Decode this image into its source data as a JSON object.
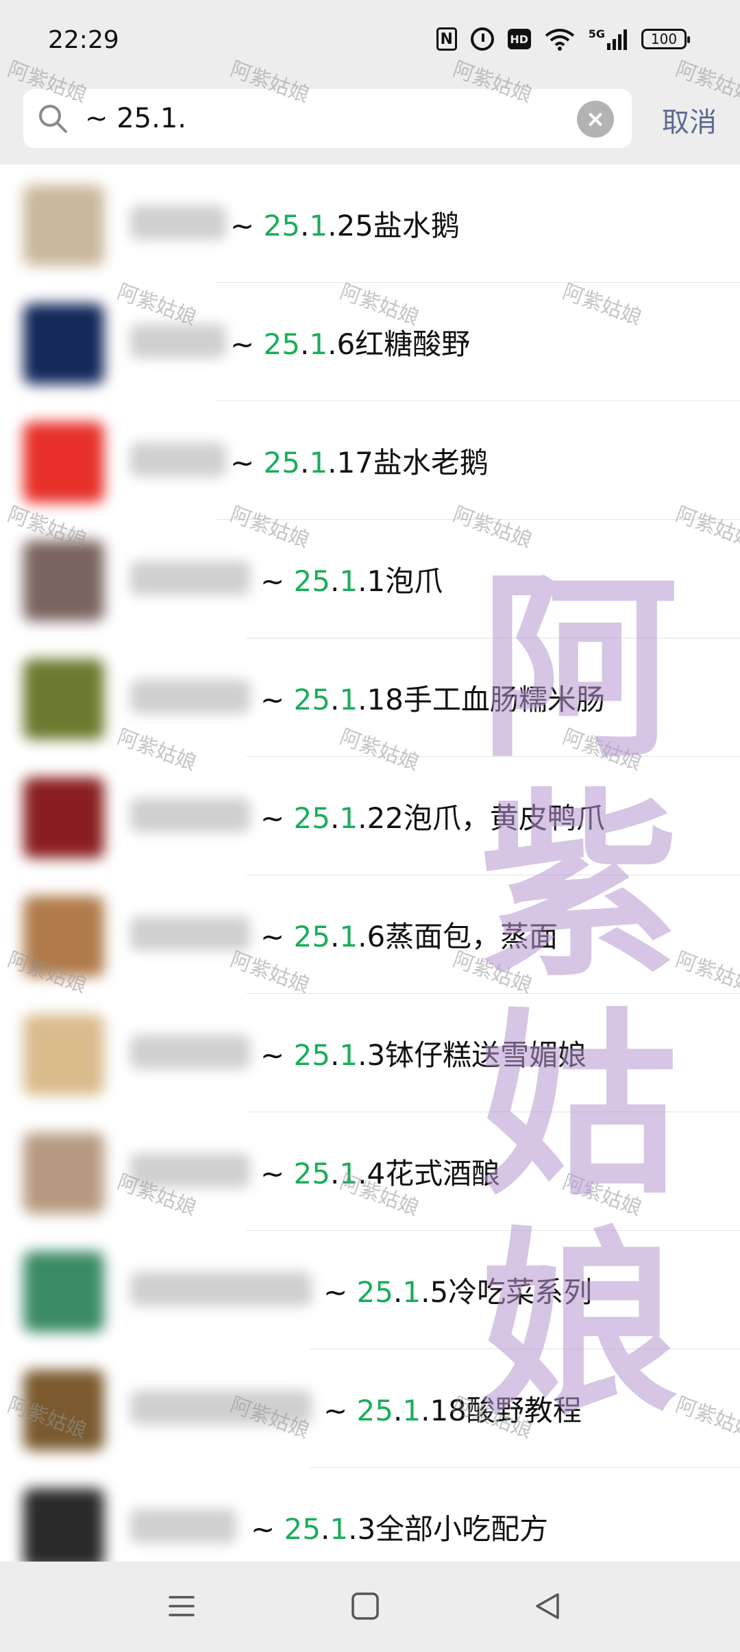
{
  "status_bar": {
    "time": "22:29",
    "icons": [
      "nfc-icon",
      "alarm-icon",
      "hd-icon",
      "wifi-icon",
      "5g-signal-icon",
      "battery-icon"
    ],
    "network": "5G",
    "hd": "HD",
    "nfc": "N",
    "battery": "100"
  },
  "search": {
    "query": "~ 25.1.",
    "cancel_label": "取消"
  },
  "results": [
    {
      "prefix": "~ ",
      "hl1": "25",
      "mid": ".",
      "hl2": "1",
      "rest": ".25盐水鹅",
      "avatar": "#c9b79a"
    },
    {
      "prefix": "~ ",
      "hl1": "25",
      "mid": ".",
      "hl2": "1",
      "rest": ".6红糖酸野",
      "avatar": "#14285a"
    },
    {
      "prefix": "~ ",
      "hl1": "25",
      "mid": ".",
      "hl2": "1",
      "rest": ".17盐水老鹅",
      "avatar": "#e8302a"
    },
    {
      "prefix": "~ ",
      "hl1": "25",
      "mid": ".",
      "hl2": "1",
      "rest": ".1泡爪",
      "avatar": "#7a6460"
    },
    {
      "prefix": "~ ",
      "hl1": "25",
      "mid": ".",
      "hl2": "1",
      "rest": ".18手工血肠糯米肠",
      "avatar": "#6b7a2e"
    },
    {
      "prefix": "~ ",
      "hl1": "25",
      "mid": ".",
      "hl2": "1",
      "rest": ".22泡爪，黄皮鸭爪",
      "avatar": "#8a1e1e"
    },
    {
      "prefix": "~ ",
      "hl1": "25",
      "mid": ".",
      "hl2": "1",
      "rest": ".6蒸面包，蒸面",
      "avatar": "#b07a4a"
    },
    {
      "prefix": "~ ",
      "hl1": "25",
      "mid": ".",
      "hl2": "1",
      "rest": ".3钵仔糕送雪媚娘",
      "avatar": "#d9bb8c"
    },
    {
      "prefix": "~ ",
      "hl1": "25",
      "mid": ".",
      "hl2": "1",
      "rest": ".4花式酒酿",
      "avatar": "#b59a80"
    },
    {
      "prefix": "~ ",
      "hl1": "25",
      "mid": ".",
      "hl2": "1",
      "rest": ".5冷吃菜系列",
      "avatar": "#3a8a66"
    },
    {
      "prefix": "~ ",
      "hl1": "25",
      "mid": ".",
      "hl2": "1",
      "rest": ".18酸野教程",
      "avatar": "#7a5a2e"
    },
    {
      "prefix": "~ ",
      "hl1": "25",
      "mid": ".",
      "hl2": "1",
      "rest": ".3全部小吃配方",
      "avatar": "#2a2a2a"
    }
  ],
  "watermark": {
    "small": "阿紫姑娘",
    "large": [
      "阿",
      "紫",
      "姑",
      "娘"
    ]
  },
  "nav": [
    "menu-icon",
    "home-square-icon",
    "back-triangle-icon"
  ],
  "colors": {
    "highlight": "#1aad5a",
    "cancel": "#5b6a92",
    "header_bg": "#ededed"
  }
}
